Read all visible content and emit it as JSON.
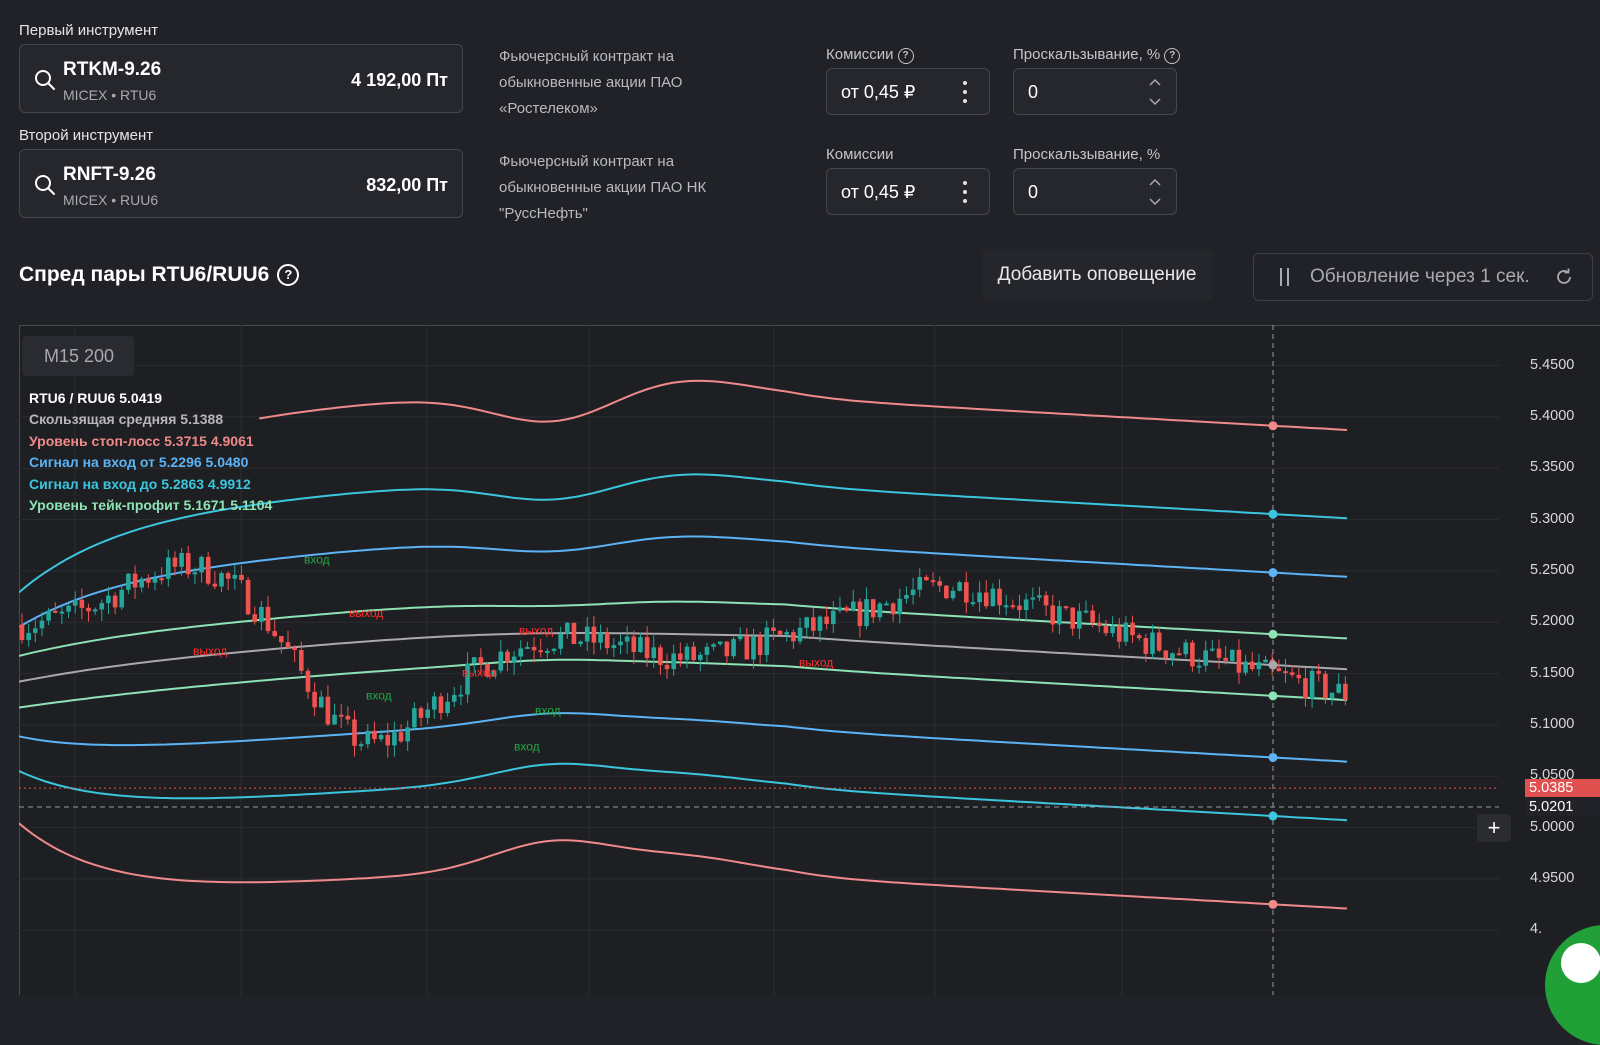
{
  "first_instrument": {
    "label": "Первый инструмент",
    "ticker": "RTKM-9.26",
    "exchange": "MICEX • RTU6",
    "price": "4 192,00 Пт",
    "description": "Фьючерсный контракт на обыкновенные акции ПАО «Ростелеком»",
    "commission_label": "Комиссии",
    "commission_value": "от 0,45 ₽",
    "slippage_label": "Проскальзывание, %",
    "slippage_value": "0"
  },
  "second_instrument": {
    "label": "Второй инструмент",
    "ticker": "RNFT-9.26",
    "exchange": "MICEX • RUU6",
    "price": "832,00 Пт",
    "description": "Фьючерсный контракт на обыкновенные акции ПАО НК \"РуссНефть\"",
    "commission_label": "Комиссии",
    "commission_value": "от 0,45 ₽",
    "slippage_label": "Проскальзывание, %",
    "slippage_value": "0"
  },
  "spread": {
    "title": "Спред пары RTU6/RUU6",
    "add_alert_label": "Добавить оповещение",
    "update_label": "Обновление через 1 сек."
  },
  "chart_data": {
    "type": "line",
    "timeframe_label": "M15 200",
    "legend": [
      {
        "text": "RTU6 / RUU6 5.0419",
        "color": "#ffffff"
      },
      {
        "text": "Скользящая средняя 5.1388",
        "color": "#b7b7bb"
      },
      {
        "text": "Уровень стоп-лосс 5.3715 4.9061",
        "color": "#f08a8a"
      },
      {
        "text": "Сигнал на вход от 5.2296 5.0480",
        "color": "#5cb3f5"
      },
      {
        "text": "Сигнал на вход до 5.2863 4.9912",
        "color": "#3ac6de"
      },
      {
        "text": "Уровень тейк-профит 5.1671 5.1104",
        "color": "#8ee3b4"
      }
    ],
    "y_ticks": [
      "5.4500",
      "5.4000",
      "5.3500",
      "5.3000",
      "5.2500",
      "5.2000",
      "5.1500",
      "5.1000",
      "5.0500",
      "5.0000",
      "4.9500",
      "4."
    ],
    "y_tick_values": [
      5.45,
      5.4,
      5.35,
      5.3,
      5.25,
      5.2,
      5.15,
      5.1,
      5.05,
      5.0,
      4.95,
      4.9
    ],
    "ylim": [
      4.895,
      5.48
    ],
    "current_price": "5.0385",
    "current_price_value": 5.0385,
    "crosshair_price": "5.0201",
    "crosshair_price_value": 5.0201,
    "markers": [
      {
        "text": "выход",
        "type": "exit"
      },
      {
        "text": "выход",
        "type": "exit"
      },
      {
        "text": "выход",
        "type": "exit"
      },
      {
        "text": "выход",
        "type": "exit"
      },
      {
        "text": "выход",
        "type": "exit"
      },
      {
        "text": "вход",
        "type": "entry"
      },
      {
        "text": "вход",
        "type": "entry"
      },
      {
        "text": "вход",
        "type": "entry"
      },
      {
        "text": "вход",
        "type": "entry"
      }
    ],
    "colors": {
      "up": "#26a69a",
      "down": "#ef5350",
      "stop_loss": "#f08a8a",
      "entry_from": "#5cb3f5",
      "entry_to": "#3ac6de",
      "take_profit": "#8ee3b4",
      "ma": "#a9a9ad"
    }
  }
}
